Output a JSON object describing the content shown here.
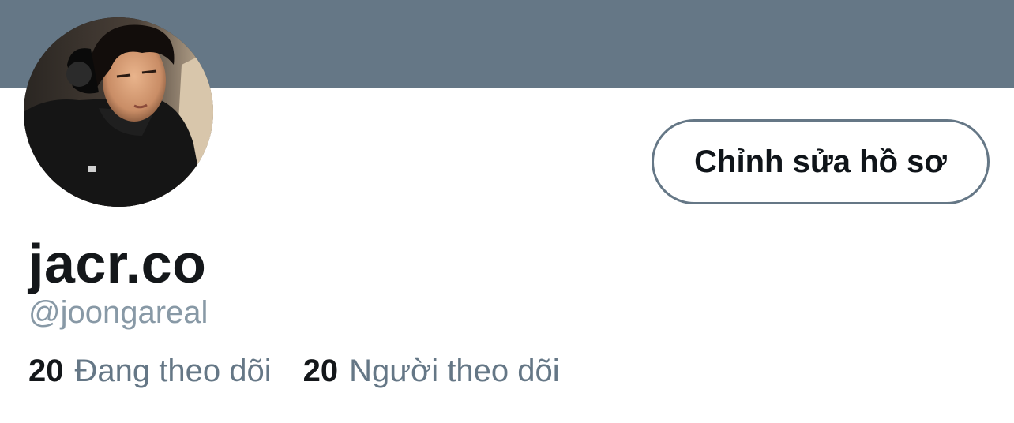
{
  "profile": {
    "display_name": "jacr.co",
    "handle": "@joongareal",
    "edit_button_label": "Chỉnh sửa hồ sơ",
    "stats": {
      "following_count": "20",
      "following_label": "Đang theo dõi",
      "followers_count": "20",
      "followers_label": "Người theo dõi"
    }
  },
  "colors": {
    "banner": "#657786",
    "text_primary": "#14171a",
    "text_secondary": "#657786",
    "button_border": "#657786"
  }
}
